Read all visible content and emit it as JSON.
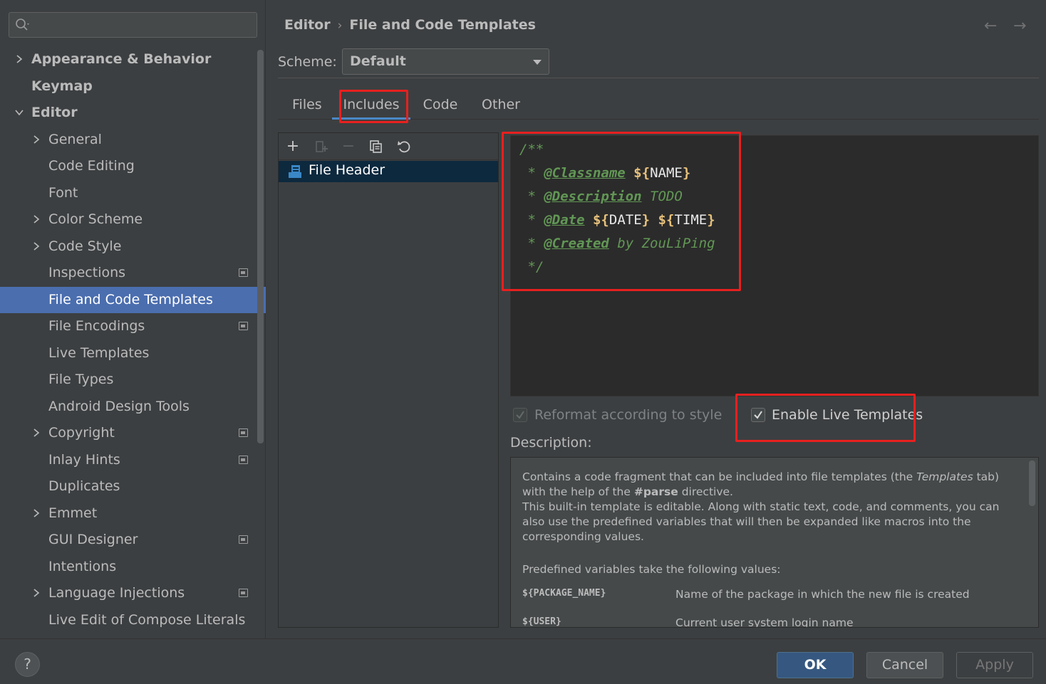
{
  "sidebar": {
    "search_placeholder": "",
    "items": [
      {
        "label": "Appearance & Behavior",
        "level": 0,
        "expandable": true,
        "expanded": false,
        "bold": true,
        "project": false
      },
      {
        "label": "Keymap",
        "level": 0,
        "expandable": false,
        "bold": true,
        "project": false
      },
      {
        "label": "Editor",
        "level": 0,
        "expandable": true,
        "expanded": true,
        "bold": true,
        "project": false
      },
      {
        "label": "General",
        "level": 1,
        "expandable": true,
        "expanded": false,
        "project": false
      },
      {
        "label": "Code Editing",
        "level": 1,
        "expandable": false,
        "project": false
      },
      {
        "label": "Font",
        "level": 1,
        "expandable": false,
        "project": false
      },
      {
        "label": "Color Scheme",
        "level": 1,
        "expandable": true,
        "expanded": false,
        "project": false
      },
      {
        "label": "Code Style",
        "level": 1,
        "expandable": true,
        "expanded": false,
        "project": false
      },
      {
        "label": "Inspections",
        "level": 1,
        "expandable": false,
        "project": true
      },
      {
        "label": "File and Code Templates",
        "level": 1,
        "expandable": false,
        "project": false,
        "selected": true
      },
      {
        "label": "File Encodings",
        "level": 1,
        "expandable": false,
        "project": true
      },
      {
        "label": "Live Templates",
        "level": 1,
        "expandable": false,
        "project": false
      },
      {
        "label": "File Types",
        "level": 1,
        "expandable": false,
        "project": false
      },
      {
        "label": "Android Design Tools",
        "level": 1,
        "expandable": false,
        "project": false
      },
      {
        "label": "Copyright",
        "level": 1,
        "expandable": true,
        "expanded": false,
        "project": true
      },
      {
        "label": "Inlay Hints",
        "level": 1,
        "expandable": false,
        "project": true
      },
      {
        "label": "Duplicates",
        "level": 1,
        "expandable": false,
        "project": false
      },
      {
        "label": "Emmet",
        "level": 1,
        "expandable": true,
        "expanded": false,
        "project": false
      },
      {
        "label": "GUI Designer",
        "level": 1,
        "expandable": false,
        "project": true
      },
      {
        "label": "Intentions",
        "level": 1,
        "expandable": false,
        "project": false
      },
      {
        "label": "Language Injections",
        "level": 1,
        "expandable": true,
        "expanded": false,
        "project": true
      },
      {
        "label": "Live Edit of Compose Literals",
        "level": 1,
        "expandable": false,
        "project": false
      }
    ]
  },
  "breadcrumb": {
    "parent": "Editor",
    "separator": "›",
    "current": "File and Code Templates"
  },
  "nav": {
    "back": "←",
    "forward": "→"
  },
  "scheme": {
    "label": "Scheme:",
    "value": "Default"
  },
  "tabs": [
    "Files",
    "Includes",
    "Code",
    "Other"
  ],
  "active_tab": "Includes",
  "template_list": {
    "toolbar": [
      "add-icon",
      "add-child-icon",
      "remove-icon",
      "copy-icon",
      "reset-icon"
    ],
    "items": [
      "File Header"
    ]
  },
  "editor": {
    "lines": [
      [
        {
          "t": "/**",
          "c": "txt"
        }
      ],
      [
        {
          "t": " * ",
          "c": "txt"
        },
        {
          "t": "@Classname",
          "c": "tag"
        },
        {
          "t": " ",
          "c": "txt"
        },
        {
          "t": "${",
          "c": "dollar"
        },
        {
          "t": "NAME",
          "c": "var"
        },
        {
          "t": "}",
          "c": "dollar"
        }
      ],
      [
        {
          "t": " * ",
          "c": "txt"
        },
        {
          "t": "@Description",
          "c": "tag"
        },
        {
          "t": " TODO",
          "c": "txt"
        }
      ],
      [
        {
          "t": " * ",
          "c": "txt"
        },
        {
          "t": "@Date",
          "c": "tag"
        },
        {
          "t": " ",
          "c": "txt"
        },
        {
          "t": "${",
          "c": "dollar"
        },
        {
          "t": "DATE",
          "c": "var"
        },
        {
          "t": "}",
          "c": "dollar"
        },
        {
          "t": " ",
          "c": "txt"
        },
        {
          "t": "${",
          "c": "dollar"
        },
        {
          "t": "TIME",
          "c": "var"
        },
        {
          "t": "}",
          "c": "dollar"
        }
      ],
      [
        {
          "t": " * ",
          "c": "txt"
        },
        {
          "t": "@Created",
          "c": "tag"
        },
        {
          "t": " by ZouLiPing",
          "c": "txt"
        }
      ],
      [
        {
          "t": " */",
          "c": "txt"
        }
      ]
    ]
  },
  "options": {
    "reformat": {
      "label": "Reformat according to style",
      "checked": true,
      "enabled": false
    },
    "live_templates": {
      "label": "Enable Live Templates",
      "checked": true,
      "enabled": true
    }
  },
  "description": {
    "label": "Description:",
    "para1_a": "Contains a code fragment that can be included into file templates (the ",
    "para1_em": "Templates",
    "para1_b": " tab) with the help of the ",
    "para1_strong": "#parse",
    "para1_c": " directive.",
    "para2": "This built-in template is editable. Along with static text, code, and comments, you can also use the predefined variables that will then be expanded like macros into the corresponding values.",
    "para3": "Predefined variables take the following values:",
    "vars": [
      {
        "name": "${PACKAGE_NAME}",
        "desc": "Name of the package in which the new file is created"
      },
      {
        "name": "${USER}",
        "desc": "Current user system login name"
      }
    ]
  },
  "buttons": {
    "help": "?",
    "ok": "OK",
    "cancel": "Cancel",
    "apply": "Apply"
  },
  "colors": {
    "accent": "#4b6eaf",
    "selection": "#4b6eaf",
    "highlight_box": "#e8201f",
    "ok_button": "#365880"
  }
}
